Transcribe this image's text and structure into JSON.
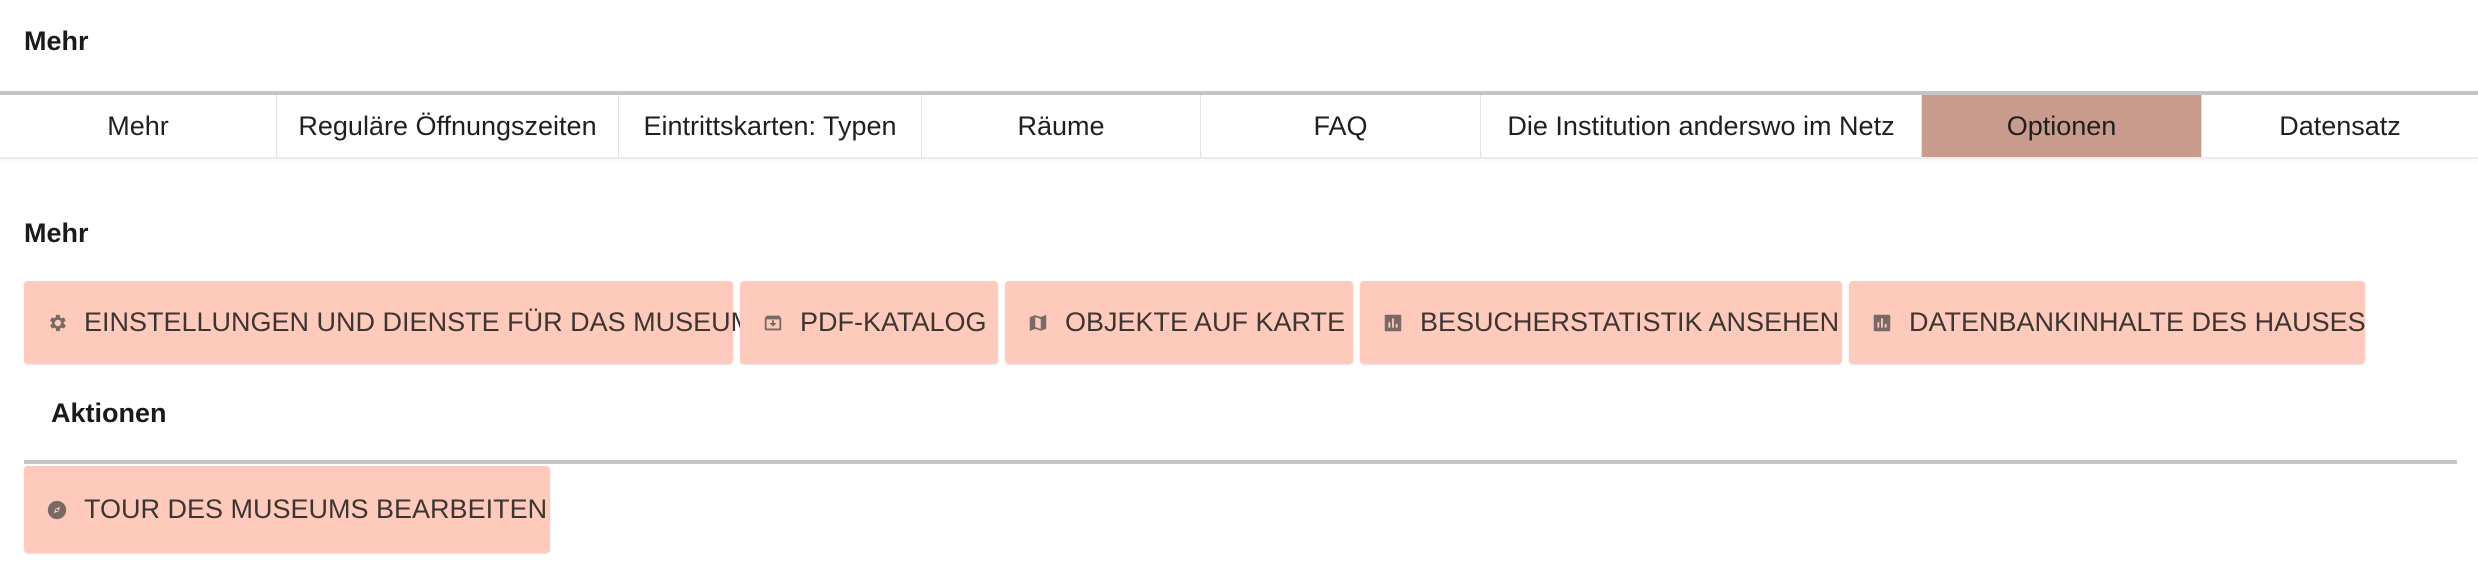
{
  "header": {
    "title": "Mehr"
  },
  "tabs": [
    {
      "label": "Mehr",
      "active": false
    },
    {
      "label": "Reguläre Öffnungszeiten",
      "active": false
    },
    {
      "label": "Eintrittskarten: Typen",
      "active": false
    },
    {
      "label": "Räume",
      "active": false
    },
    {
      "label": "FAQ",
      "active": false
    },
    {
      "label": "Die Institution anderswo im Netz",
      "active": false
    },
    {
      "label": "Optionen",
      "active": true
    },
    {
      "label": "Datensatz",
      "active": false
    }
  ],
  "section": {
    "title": "Mehr",
    "buttons": [
      {
        "label": "EINSTELLUNGEN UND DIENSTE FÜR DAS MUSEUM",
        "icon": "gear-icon"
      },
      {
        "label": "PDF-KATALOG",
        "icon": "archive-box-icon"
      },
      {
        "label": "OBJEKTE AUF KARTE",
        "icon": "map-icon"
      },
      {
        "label": "BESUCHERSTATISTIK ANSEHEN",
        "icon": "bar-chart-icon"
      },
      {
        "label": "DATENBANKINHALTE DES HAUSES",
        "icon": "bar-chart-icon"
      }
    ]
  },
  "actions": {
    "title": "Aktionen",
    "buttons": [
      {
        "label": "TOUR DES MUSEUMS BEARBEITEN",
        "icon": "compass-icon"
      }
    ]
  },
  "colors": {
    "button_bg": "#fecabb",
    "active_tab_bg": "#c99b8c",
    "rule": "#c4c4c4",
    "icon": "#7a6a66"
  }
}
